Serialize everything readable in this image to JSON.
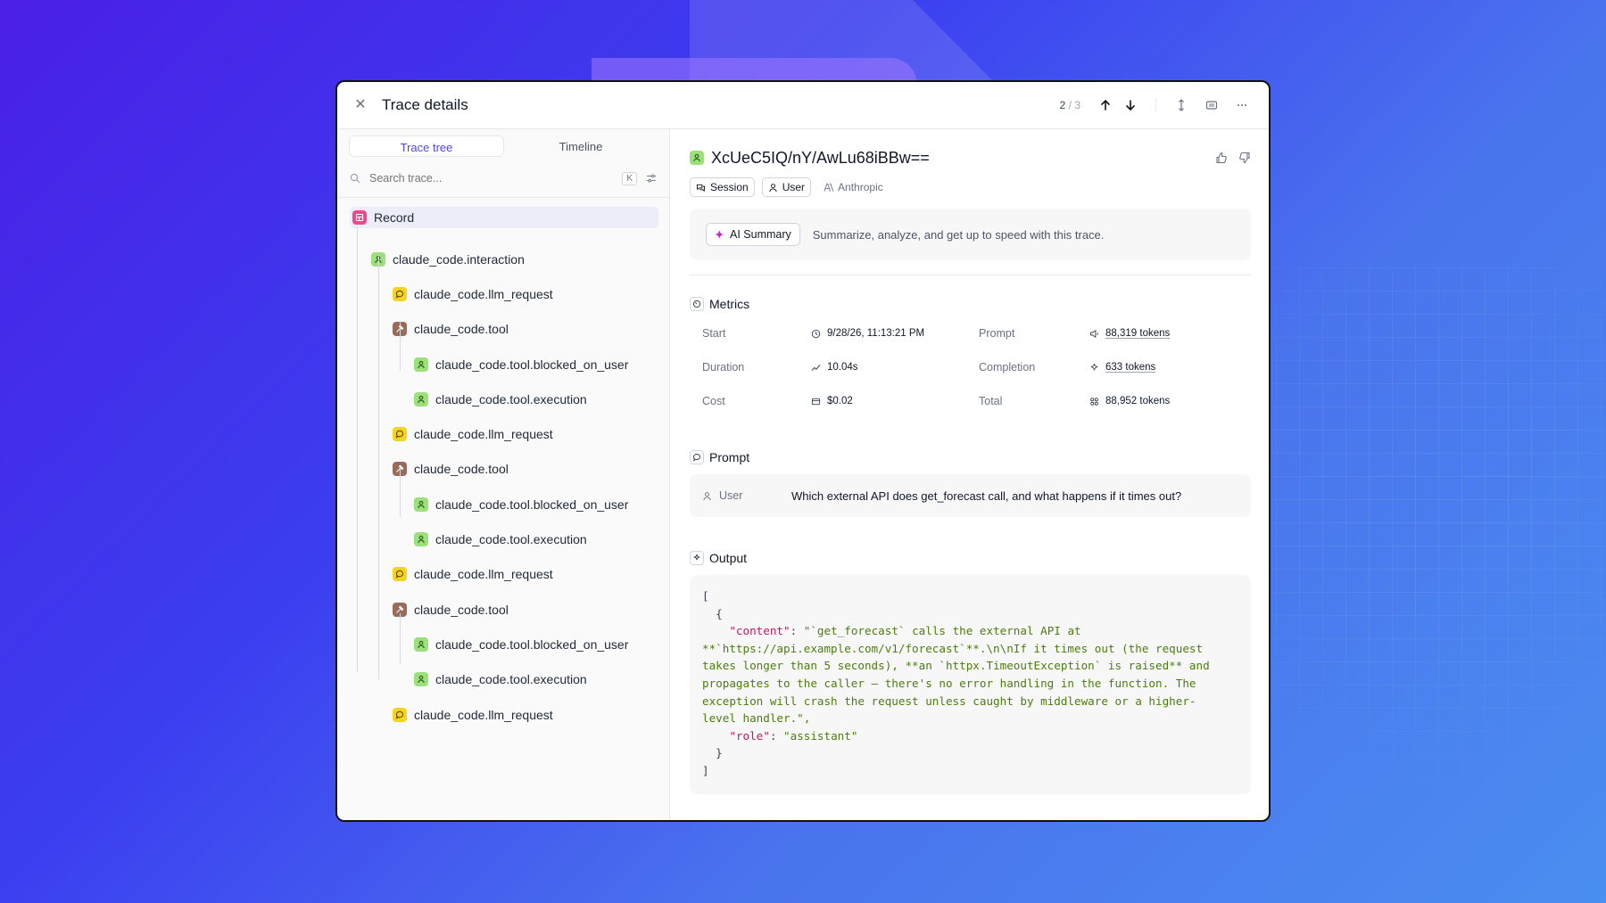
{
  "window": {
    "title": "Trace details",
    "pager": {
      "current": "2",
      "total": "/ 3"
    }
  },
  "left": {
    "tabs": [
      {
        "label": "Trace tree",
        "active": true
      },
      {
        "label": "Timeline",
        "active": false
      }
    ],
    "search": {
      "placeholder": "Search trace...",
      "shortcut": "K"
    },
    "tree": [
      {
        "label": "Record",
        "icon": "record-icon",
        "depth": 0,
        "selected": true
      },
      {
        "label": "claude_code.interaction",
        "icon": "person-icon",
        "depth": 1
      },
      {
        "label": "claude_code.llm_request",
        "icon": "chat-bubble-icon",
        "depth": 2
      },
      {
        "label": "claude_code.tool",
        "icon": "hammer-icon",
        "depth": 2
      },
      {
        "label": "claude_code.tool.blocked_on_user",
        "icon": "person-icon",
        "depth": 3
      },
      {
        "label": "claude_code.tool.execution",
        "icon": "person-icon",
        "depth": 3
      },
      {
        "label": "claude_code.llm_request",
        "icon": "chat-bubble-icon",
        "depth": 2
      },
      {
        "label": "claude_code.tool",
        "icon": "hammer-icon",
        "depth": 2
      },
      {
        "label": "claude_code.tool.blocked_on_user",
        "icon": "person-icon",
        "depth": 3
      },
      {
        "label": "claude_code.tool.execution",
        "icon": "person-icon",
        "depth": 3
      },
      {
        "label": "claude_code.llm_request",
        "icon": "chat-bubble-icon",
        "depth": 2
      },
      {
        "label": "claude_code.tool",
        "icon": "hammer-icon",
        "depth": 2
      },
      {
        "label": "claude_code.tool.blocked_on_user",
        "icon": "person-icon",
        "depth": 3
      },
      {
        "label": "claude_code.tool.execution",
        "icon": "person-icon",
        "depth": 3
      },
      {
        "label": "claude_code.llm_request",
        "icon": "chat-bubble-icon",
        "depth": 2
      }
    ]
  },
  "detail": {
    "trace_id": "XcUeC5IQ/nY/AwLu68iBBw==",
    "badges": {
      "session": "Session",
      "user": "User",
      "provider": "Anthropic"
    },
    "ai_summary": {
      "button": "AI Summary",
      "text": "Summarize, analyze, and get up to speed with this trace."
    },
    "metrics": {
      "title": "Metrics",
      "start_label": "Start",
      "start_value": "9/28/26, 11:13:21 PM",
      "prompt_label": "Prompt",
      "prompt_value": "88,319 tokens",
      "duration_label": "Duration",
      "duration_value": "10.04s",
      "completion_label": "Completion",
      "completion_value": "633 tokens",
      "cost_label": "Cost",
      "cost_value": "$0.02",
      "total_label": "Total",
      "total_value": "88,952 tokens"
    },
    "prompt": {
      "title": "Prompt",
      "role": "User",
      "text": "Which external API does get_forecast call, and what happens if it times out?"
    },
    "output": {
      "title": "Output",
      "content_key": "\"content\"",
      "content_value": "\"`get_forecast` calls the external API at\n**`https://api.example.com/v1/forecast`**.\\n\\nIf it times out (the request\ntakes longer than 5 seconds), **an `httpx.TimeoutException` is raised** and\npropagates to the caller — there's no error handling in the function. The\nexception will crash the request unless caught by middleware or a higher-\nlevel handler.\",",
      "role_key": "\"role\"",
      "role_value": "\"assistant\""
    }
  },
  "colors": {
    "accent": "#4f46e5",
    "record": "#e44d8a",
    "green": "#9be07a",
    "yellow": "#f5d321",
    "brown": "#9a6b5a",
    "json_key": "#c2185b",
    "json_string": "#4d7c0f"
  }
}
